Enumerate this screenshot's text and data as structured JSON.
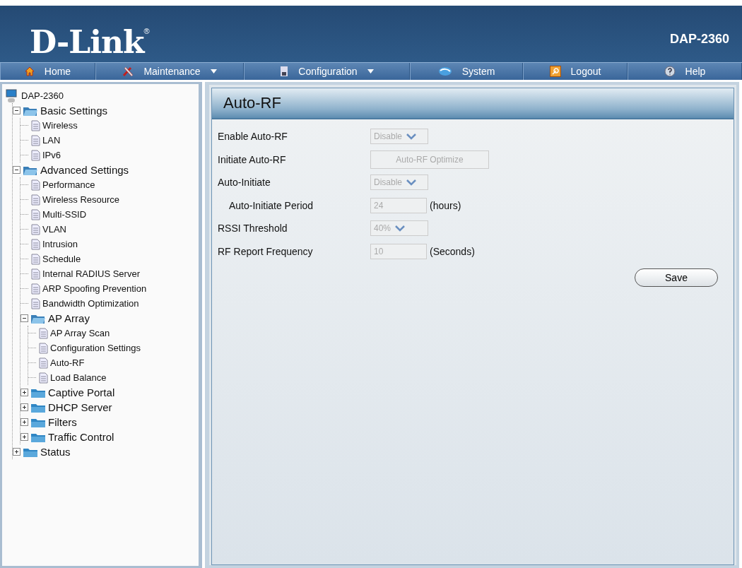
{
  "header": {
    "logo": "D-Link",
    "registered": "®",
    "model": "DAP-2360"
  },
  "nav": [
    {
      "label": "Home",
      "kind": "home",
      "menu": false
    },
    {
      "label": "Maintenance",
      "kind": "tools",
      "menu": true
    },
    {
      "label": "Configuration",
      "kind": "disk",
      "menu": true
    },
    {
      "label": "System",
      "kind": "globe",
      "menu": false
    },
    {
      "label": "Logout",
      "kind": "key",
      "menu": false
    },
    {
      "label": "Help",
      "kind": "help",
      "menu": false
    }
  ],
  "tree": [
    {
      "label": "DAP-2360",
      "kind": "device",
      "children": [
        {
          "label": "Basic Settings",
          "kind": "folder",
          "expanded": true,
          "children": [
            {
              "label": "Wireless",
              "kind": "page"
            },
            {
              "label": "LAN",
              "kind": "page"
            },
            {
              "label": "IPv6",
              "kind": "page"
            }
          ]
        },
        {
          "label": "Advanced Settings",
          "kind": "folder",
          "expanded": true,
          "children": [
            {
              "label": "Performance",
              "kind": "page"
            },
            {
              "label": "Wireless Resource",
              "kind": "page"
            },
            {
              "label": "Multi-SSID",
              "kind": "page"
            },
            {
              "label": "VLAN",
              "kind": "page"
            },
            {
              "label": "Intrusion",
              "kind": "page"
            },
            {
              "label": "Schedule",
              "kind": "page"
            },
            {
              "label": "Internal RADIUS Server",
              "kind": "page"
            },
            {
              "label": "ARP Spoofing Prevention",
              "kind": "page"
            },
            {
              "label": "Bandwidth Optimization",
              "kind": "page"
            },
            {
              "label": "AP Array",
              "kind": "folder",
              "expanded": true,
              "children": [
                {
                  "label": "AP Array Scan",
                  "kind": "page"
                },
                {
                  "label": "Configuration Settings",
                  "kind": "page"
                },
                {
                  "label": "Auto-RF",
                  "kind": "page"
                },
                {
                  "label": "Load Balance",
                  "kind": "page"
                }
              ]
            },
            {
              "label": "Captive Portal",
              "kind": "folder",
              "expanded": false
            },
            {
              "label": "DHCP Server",
              "kind": "folder",
              "expanded": false
            },
            {
              "label": "Filters",
              "kind": "folder",
              "expanded": false
            },
            {
              "label": "Traffic Control",
              "kind": "folder",
              "expanded": false
            }
          ]
        },
        {
          "label": "Status",
          "kind": "folder",
          "expanded": false
        }
      ]
    }
  ],
  "panel": {
    "title": "Auto-RF",
    "fields": [
      {
        "label": "Enable Auto-RF",
        "kind": "select",
        "value": "Disable",
        "disabled": true
      },
      {
        "label": "Initiate Auto-RF",
        "kind": "button",
        "value": "Auto-RF Optimize",
        "disabled": true
      },
      {
        "label": "Auto-Initiate",
        "kind": "select",
        "value": "Disable",
        "disabled": true,
        "children": [
          {
            "label": "Auto-Initiate Period",
            "kind": "text",
            "value": "24",
            "unit": "(hours)",
            "disabled": true
          }
        ]
      },
      {
        "label": "RSSI Threshold",
        "kind": "select",
        "value": "40%",
        "disabled": true
      },
      {
        "label": "RF Report Frequency",
        "kind": "text",
        "value": "10",
        "unit": "(Seconds)",
        "disabled": true
      }
    ],
    "save": "Save"
  }
}
